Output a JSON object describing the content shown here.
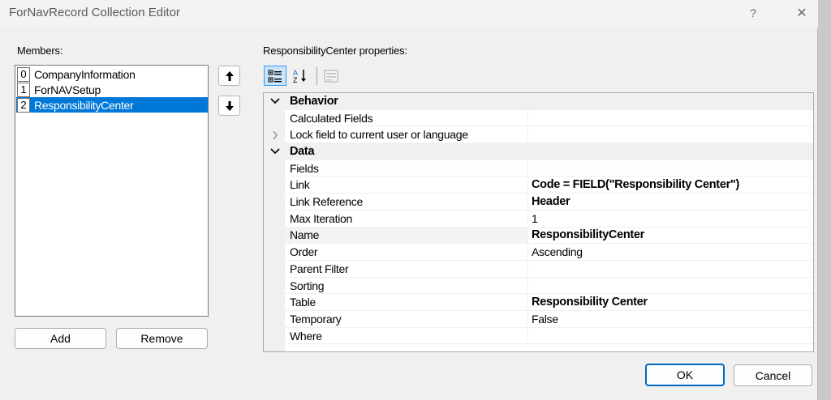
{
  "window": {
    "title": "ForNavRecord Collection Editor",
    "help_glyph": "?",
    "close_glyph": "✕"
  },
  "members": {
    "label": "Members:",
    "items": [
      {
        "index": "0",
        "name": "CompanyInformation",
        "selected": false
      },
      {
        "index": "1",
        "name": "ForNAVSetup",
        "selected": false
      },
      {
        "index": "2",
        "name": "ResponsibilityCenter",
        "selected": true
      }
    ],
    "add_label": "Add",
    "remove_label": "Remove"
  },
  "properties": {
    "label": "ResponsibilityCenter properties:",
    "toolbar": {
      "categorized_icon": "categorized-icon",
      "alphabetical_icon": "alphabetical-sort-icon",
      "property_pages_icon": "property-pages-icon"
    },
    "rows": [
      {
        "type": "category",
        "name": "Behavior",
        "expanded": true
      },
      {
        "type": "prop",
        "name": "Calculated Fields",
        "value": ""
      },
      {
        "type": "prop",
        "name": "Lock field to current user or language",
        "value": "",
        "expandable": true
      },
      {
        "type": "category",
        "name": "Data",
        "expanded": true
      },
      {
        "type": "prop",
        "name": "Fields",
        "value": ""
      },
      {
        "type": "prop",
        "name": "Link",
        "value": "Code = FIELD(\"Responsibility Center\")",
        "bold": true
      },
      {
        "type": "prop",
        "name": "Link Reference",
        "value": "Header",
        "bold": true
      },
      {
        "type": "prop",
        "name": "Max Iteration",
        "value": "1"
      },
      {
        "type": "prop",
        "name": "Name",
        "value": "ResponsibilityCenter",
        "bold": true,
        "highlight": true
      },
      {
        "type": "prop",
        "name": "Order",
        "value": "Ascending"
      },
      {
        "type": "prop",
        "name": "Parent Filter",
        "value": ""
      },
      {
        "type": "prop",
        "name": "Sorting",
        "value": ""
      },
      {
        "type": "prop",
        "name": "Table",
        "value": "Responsibility Center",
        "bold": true
      },
      {
        "type": "prop",
        "name": "Temporary",
        "value": "False"
      },
      {
        "type": "prop",
        "name": "Where",
        "value": ""
      }
    ]
  },
  "footer": {
    "ok_label": "OK",
    "cancel_label": "Cancel"
  },
  "colors": {
    "selection": "#0078d7",
    "accent": "#0067c0"
  }
}
